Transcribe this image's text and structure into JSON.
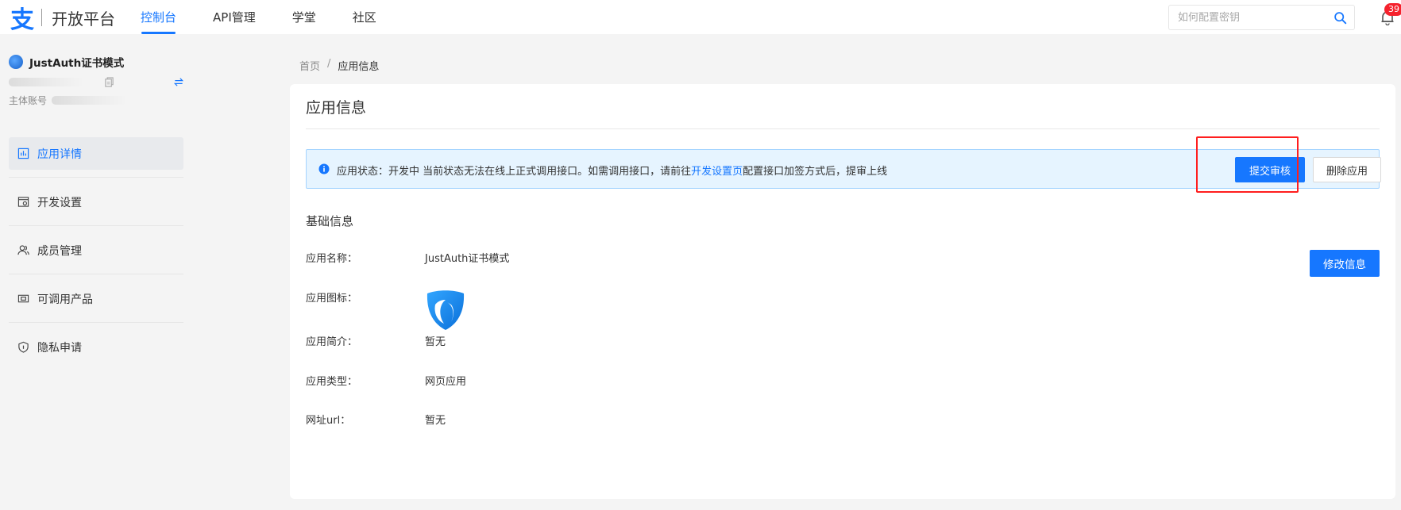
{
  "header": {
    "logo_text": "开放平台",
    "nav": [
      {
        "label": "控制台",
        "active": true
      },
      {
        "label": "API管理",
        "active": false
      },
      {
        "label": "学堂",
        "active": false
      },
      {
        "label": "社区",
        "active": false
      }
    ],
    "search": {
      "placeholder": "如何配置密钥",
      "value": ""
    },
    "notification_count": "39"
  },
  "sidebar": {
    "account": {
      "name": "JustAuth证书模式",
      "sub_label": "主体账号"
    },
    "items": [
      {
        "label": "应用详情",
        "icon": "chart-icon",
        "active": true
      },
      {
        "label": "开发设置",
        "icon": "settings-icon",
        "active": false
      },
      {
        "label": "成员管理",
        "icon": "members-icon",
        "active": false
      },
      {
        "label": "可调用产品",
        "icon": "product-icon",
        "active": false
      },
      {
        "label": "隐私申请",
        "icon": "shield-icon",
        "active": false
      }
    ]
  },
  "breadcrumb": {
    "home": "首页",
    "separator": "/",
    "current": "应用信息"
  },
  "main": {
    "title": "应用信息",
    "alert": {
      "text_before": "应用状态：开发中 当前状态无法在线上正式调用接口。如需调用接口，请前往",
      "link": "开发设置页",
      "text_after": "配置接口加签方式后，提审上线"
    },
    "buttons": {
      "submit": "提交审核",
      "delete": "删除应用",
      "edit": "修改信息"
    },
    "section_title": "基础信息",
    "fields": [
      {
        "label": "应用名称：",
        "value": "JustAuth证书模式"
      },
      {
        "label": "应用图标：",
        "value": ""
      },
      {
        "label": "应用简介：",
        "value": "暂无"
      },
      {
        "label": "应用类型：",
        "value": "网页应用"
      },
      {
        "label": "网址url：",
        "value": "暂无"
      }
    ]
  },
  "colors": {
    "accent": "#1677ff",
    "highlight": "#ff1e1e",
    "badge": "#f5222d"
  }
}
